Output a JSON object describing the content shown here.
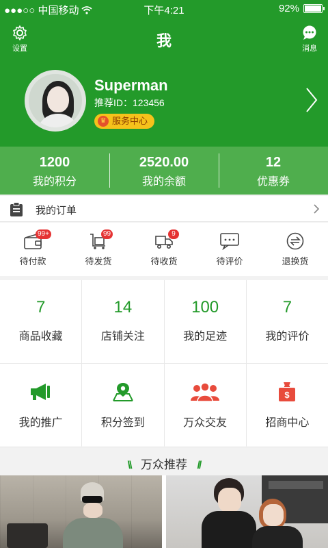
{
  "status_bar": {
    "carrier": "●●●○○ 中国移动",
    "time": "下午4:21",
    "battery": "92%",
    "battery_level": 0.92
  },
  "nav": {
    "title": "我",
    "settings_label": "设置",
    "messages_label": "消息"
  },
  "profile": {
    "username": "Superman",
    "recommend_id": "推荐ID：123456",
    "service_center": "服务中心"
  },
  "stats": [
    {
      "value": "1200",
      "label": "我的积分"
    },
    {
      "value": "2520.00",
      "label": "我的余额"
    },
    {
      "value": "12",
      "label": "优惠券"
    }
  ],
  "orders": {
    "title": "我的订单",
    "items": [
      {
        "label": "待付款",
        "badge": "99+",
        "icon": "wallet-icon"
      },
      {
        "label": "待发货",
        "badge": "99",
        "icon": "cart-icon"
      },
      {
        "label": "待收货",
        "badge": "9",
        "icon": "truck-icon"
      },
      {
        "label": "待评价",
        "badge": "",
        "icon": "comment-icon"
      },
      {
        "label": "退换货",
        "badge": "",
        "icon": "exchange-icon"
      }
    ]
  },
  "counters": [
    {
      "value": "7",
      "label": "商品收藏"
    },
    {
      "value": "14",
      "label": "店铺关注"
    },
    {
      "value": "100",
      "label": "我的足迹"
    },
    {
      "value": "7",
      "label": "我的评价"
    }
  ],
  "features": [
    {
      "label": "我的推广",
      "icon": "megaphone-icon",
      "color": "#239a2a"
    },
    {
      "label": "积分签到",
      "icon": "location-pin-icon",
      "color": "#239a2a"
    },
    {
      "label": "万众交友",
      "icon": "friends-icon",
      "color": "#e84b3c"
    },
    {
      "label": "招商中心",
      "icon": "money-bag-icon",
      "color": "#e84b3c"
    }
  ],
  "recommend": {
    "title": "万众推荐"
  },
  "colors": {
    "brand_green": "#239a2a",
    "stats_green": "#4fae4d",
    "badge_red": "#e53333",
    "accent_red": "#e84b3c",
    "service_yellow": "#f6c21b"
  }
}
